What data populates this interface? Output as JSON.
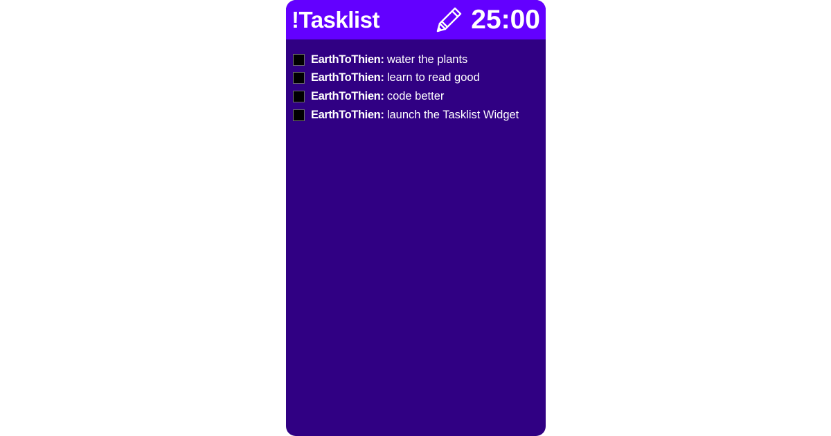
{
  "widget": {
    "title": "!Tasklist",
    "timer": "25:00",
    "edit_icon": "pencil-icon"
  },
  "colors": {
    "header_bg": "#6300ff",
    "body_bg": "#300083",
    "text": "#ffffff",
    "checkbox": "#000000"
  },
  "tasks": [
    {
      "user": "EarthToThien",
      "separator": ":",
      "text": "water the plants",
      "checked": false
    },
    {
      "user": "EarthToThien",
      "separator": ":",
      "text": "learn to read good",
      "checked": false
    },
    {
      "user": "EarthToThien",
      "separator": ":",
      "text": "code better",
      "checked": false
    },
    {
      "user": "EarthToThien",
      "separator": ":",
      "text": "launch the Tasklist Widget",
      "checked": false
    }
  ]
}
